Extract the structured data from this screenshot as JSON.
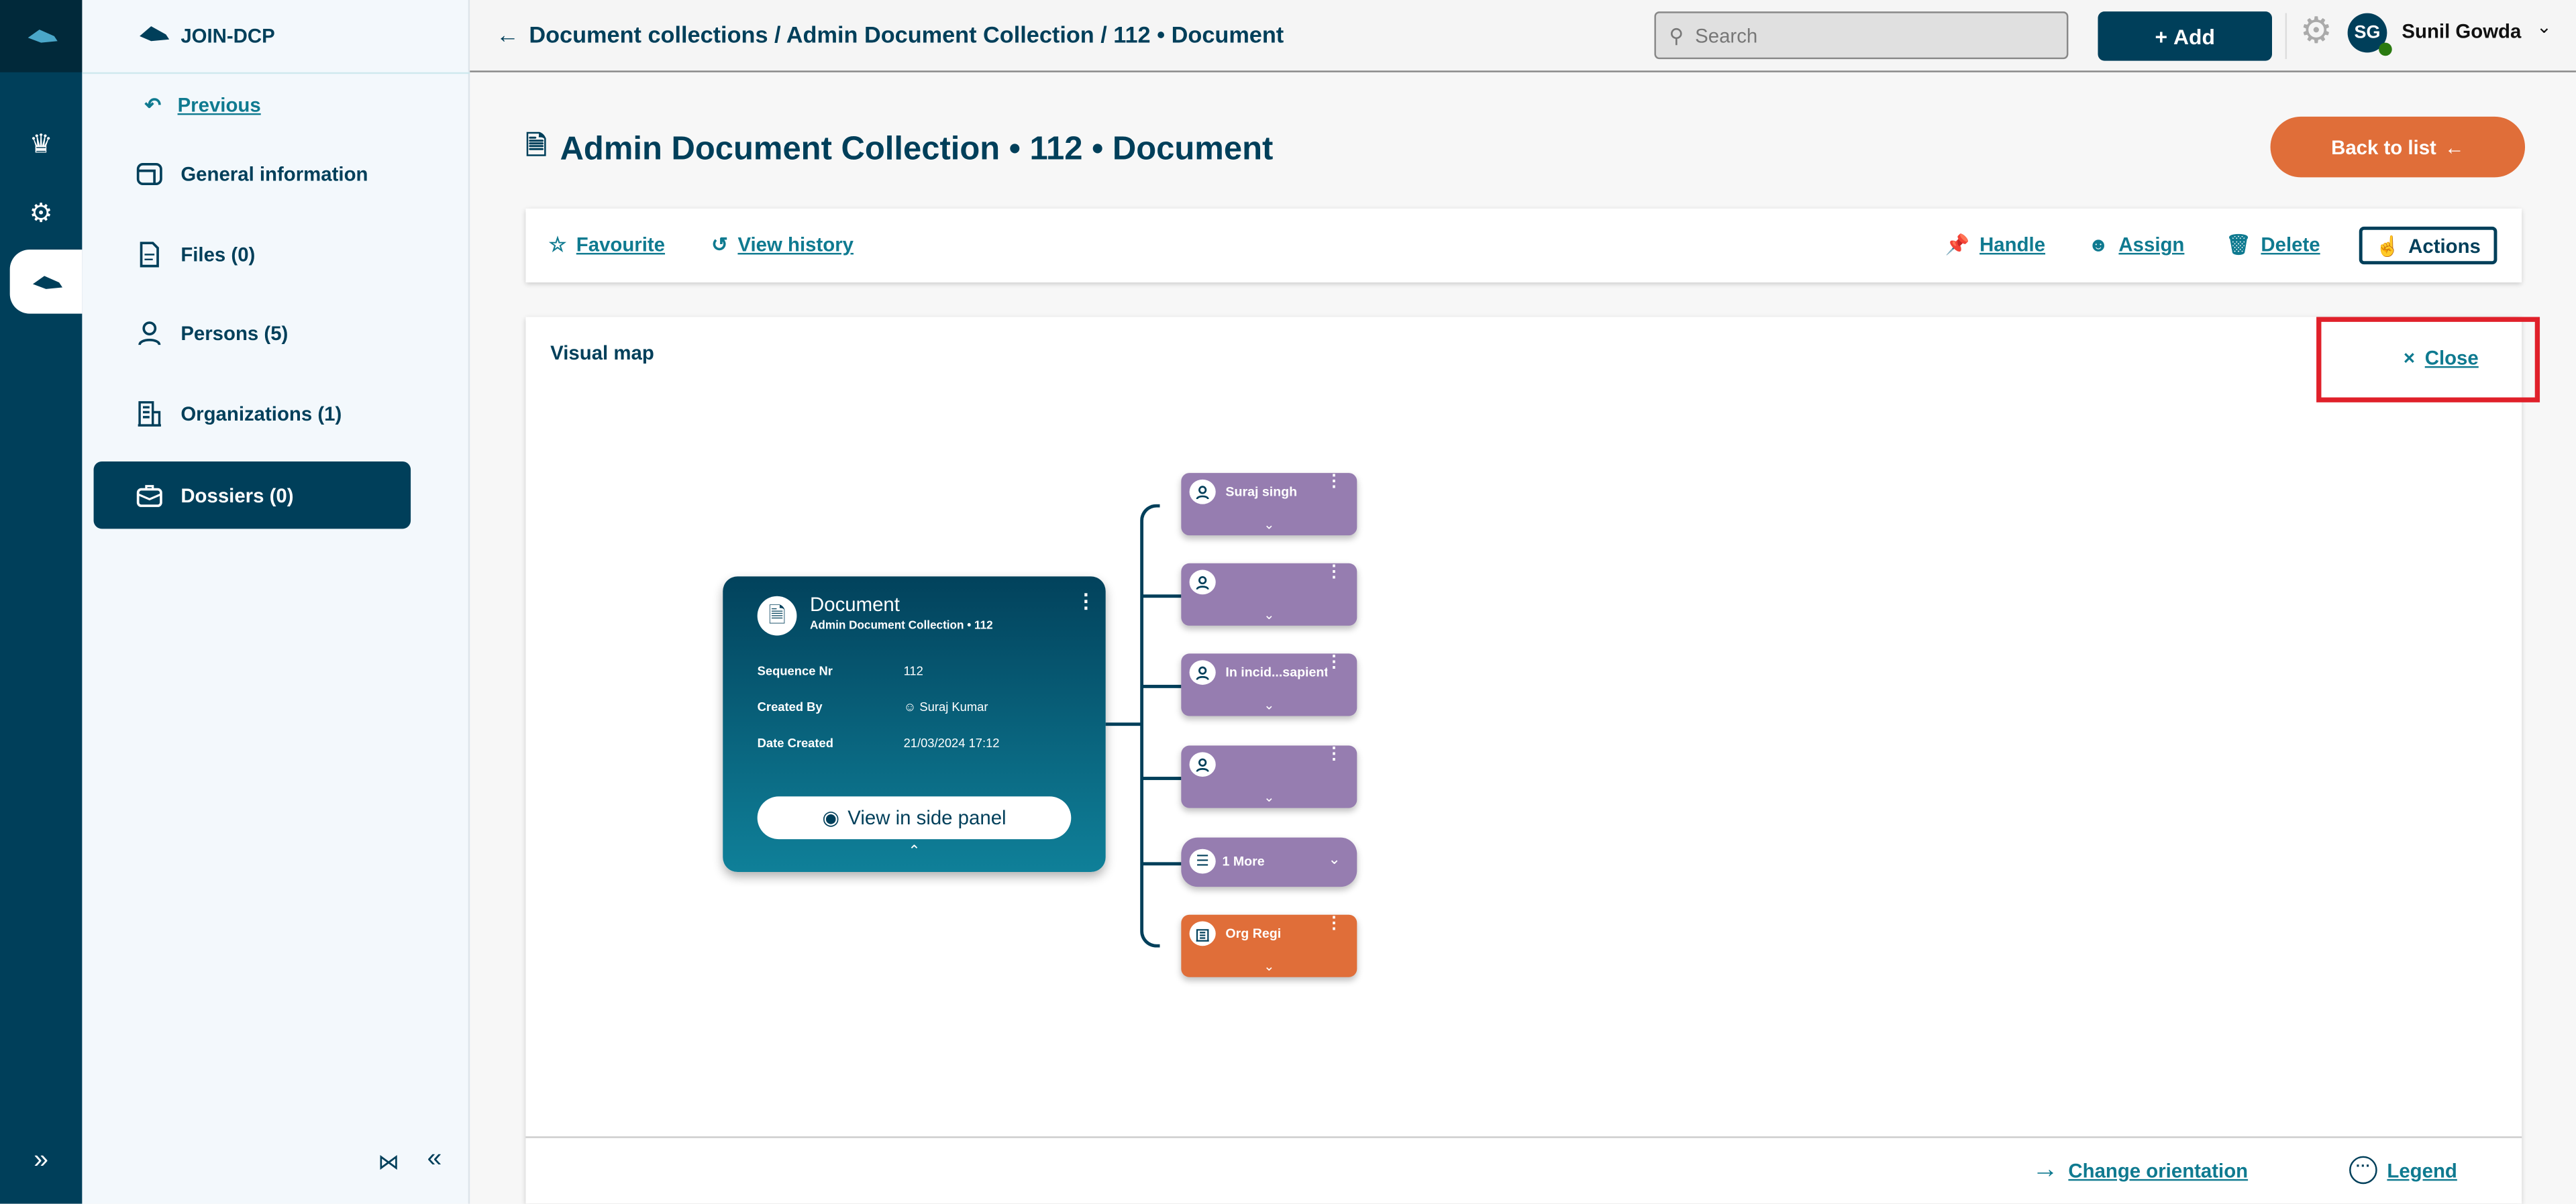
{
  "app": {
    "name": "JOIN-DCP"
  },
  "sidebar": {
    "previous": "Previous",
    "items": [
      {
        "label": "General information",
        "icon": "window-icon"
      },
      {
        "label": "Files (0)",
        "icon": "file-icon"
      },
      {
        "label": "Persons (5)",
        "icon": "person-icon"
      },
      {
        "label": "Organizations (1)",
        "icon": "building-icon"
      },
      {
        "label": "Dossiers (0)",
        "icon": "briefcase-icon",
        "active": true
      }
    ]
  },
  "topbar": {
    "breadcrumb": "Document collections / Admin Document Collection / 112 • Document",
    "search_placeholder": "Search",
    "add_label": "Add",
    "user_initials": "SG",
    "user_name": "Sunil Gowda"
  },
  "page": {
    "title": "Admin Document Collection • 112 • Document",
    "back_label": "Back to list"
  },
  "toolbar": {
    "favourite": "Favourite",
    "view_history": "View history",
    "handle": "Handle",
    "assign": "Assign",
    "delete": "Delete",
    "actions": "Actions"
  },
  "visual_map": {
    "title": "Visual map",
    "close": "Close",
    "change_orientation": "Change orientation",
    "legend": "Legend",
    "document": {
      "title": "Document",
      "subtitle": "Admin Document Collection • 112",
      "fields": [
        {
          "label": "Sequence Nr",
          "value": "112"
        },
        {
          "label": "Created By",
          "value": "Suraj Kumar"
        },
        {
          "label": "Date Created",
          "value": "21/03/2024 17:12"
        }
      ],
      "view_button": "View in side panel"
    },
    "nodes": [
      {
        "label": "Suraj singh",
        "type": "person"
      },
      {
        "label": "",
        "type": "person"
      },
      {
        "label": "In incid...sapiente",
        "type": "person"
      },
      {
        "label": "",
        "type": "person"
      },
      {
        "label": "1 More",
        "type": "more"
      },
      {
        "label": "Org Regi",
        "type": "organization"
      }
    ]
  },
  "colors": {
    "primary": "#003f5a",
    "accent": "#e06e39",
    "person_node": "#967db0",
    "link": "#0f7a90",
    "highlight": "#e0202a"
  }
}
